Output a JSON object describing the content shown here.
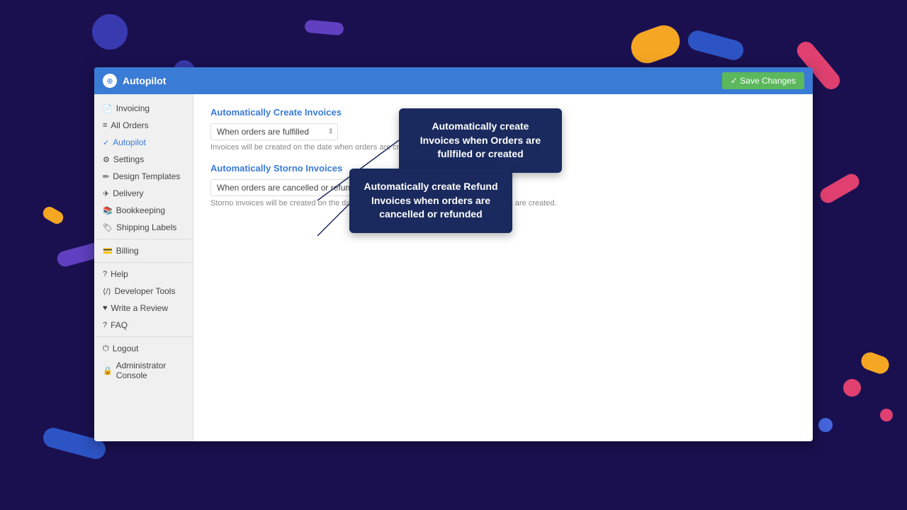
{
  "app": {
    "title": "Autopilot",
    "save_button": "✓ Save Changes"
  },
  "sidebar": {
    "invoicing_label": "Invoicing",
    "all_orders_label": "All Orders",
    "autopilot_label": "Autopilot",
    "settings_label": "Settings",
    "design_templates_label": "Design Templates",
    "delivery_label": "Delivery",
    "bookkeeping_label": "Bookkeeping",
    "shipping_labels_label": "Shipping Labels",
    "billing_label": "Billing",
    "help_label": "Help",
    "developer_tools_label": "Developer Tools",
    "write_review_label": "Write a Review",
    "faq_label": "FAQ",
    "logout_label": "Logout",
    "admin_console_label": "Administrator Console"
  },
  "main": {
    "auto_create_invoices_title": "Automatically Create Invoices",
    "auto_create_invoices_select": "When orders are fulfilled",
    "auto_create_invoices_helper": "Invoices will be created on the date when orders are created or fulfilled.",
    "auto_storno_title": "Automatically Storno Invoices",
    "auto_storno_select": "When orders are cancelled or refunded",
    "auto_storno_helper": "Storno invoices will be created on the date when orders are voided/cancelled or refunds are created.",
    "tooltip1_text": "Automatically create Invoices when Orders are fullfiled or created",
    "tooltip2_text": "Automatically create Refund Invoices when orders are cancelled or refunded"
  }
}
